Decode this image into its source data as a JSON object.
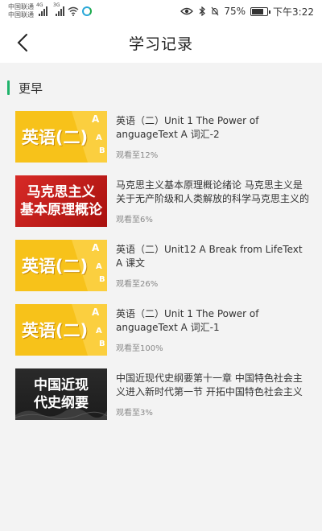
{
  "status_bar": {
    "carrier1": "中国联通",
    "carrier2": "中国联通",
    "net1": "4G",
    "net2": "3G",
    "battery": "75%",
    "battery_level": 0.75,
    "time": "下午3:22"
  },
  "header": {
    "title": "学习记录"
  },
  "section": {
    "title": "更早"
  },
  "items": [
    {
      "thumb_style": "yellow",
      "thumb_text": "英语(二)",
      "title": "英语（二）Unit 1 The Power of anguageText A 词汇-2",
      "progress": "观看至12%"
    },
    {
      "thumb_style": "red",
      "thumb_line1": "马克思主义",
      "thumb_line2": "基本原理概论",
      "title": "马克思主义基本原理概论绪论 马克思主义是关于无产阶级和人类解放的科学马克思主义的产生发...",
      "progress": "观看至6%"
    },
    {
      "thumb_style": "yellow",
      "thumb_text": "英语(二)",
      "title": "英语（二）Unit12 A Break from LifeText A  课文",
      "progress": "观看至26%"
    },
    {
      "thumb_style": "yellow",
      "thumb_text": "英语(二)",
      "title": "英语（二）Unit 1 The Power of anguageText A  词汇-1",
      "progress": "观看至100%"
    },
    {
      "thumb_style": "dark",
      "thumb_line1": "中国近现",
      "thumb_line2": "代史纲要",
      "title": "中国近现代史纲要第十一章  中国特色社会主义进入新时代第一节  开拓中国特色社会主义更为广...",
      "progress": "观看至3%"
    }
  ]
}
